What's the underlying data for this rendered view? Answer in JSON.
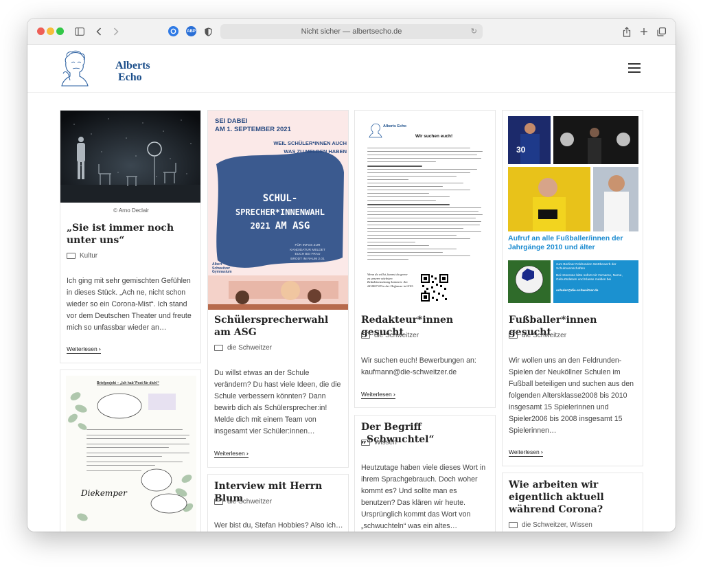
{
  "browser": {
    "address": "Nicht sicher — albertsecho.de",
    "reload_icon": "reload-icon",
    "colors": {
      "close": "#ee5f57",
      "minimize": "#f6bd3b",
      "zoom": "#33c748"
    }
  },
  "site": {
    "logo_line1": "Alberts",
    "logo_line2": "Echo",
    "brand_color": "#1b4e8a"
  },
  "posts": [
    {
      "caption": "© Arno Declair",
      "title": "„Sie ist immer noch unter uns“",
      "category": "Kultur",
      "excerpt": "Ich ging mit sehr gemischten Gefühlen in dieses Stück. „Ach ne, nicht schon wieder so ein Corona-Mist“. Ich stand vor dem Deutschen Theater und freute mich so unfassbar wieder an…",
      "more": "Weiterlesen"
    },
    {
      "image_text": {
        "line1": "SEI DABEI",
        "line2": "AM 1. SEPTEMBER 2021",
        "line3": "WEIL SCHÜLER*INNEN AUCH",
        "line4": "WAS ZU MELDEN HABEN",
        "line5": "SCHUL-",
        "line6": "SPRECHER*INNENWAHL",
        "line7": "2021",
        "line8": "AM ASG",
        "info1": "FÜR INFOS ZUR",
        "info2": "KANDIDATUR MELDET",
        "info3": "EUCH BEI FRAU",
        "info4": "BRODT IM RAUM 2.01",
        "logo1": "Albert",
        "logo2": "Schweitzer",
        "logo3": "Gymnasium"
      },
      "title": "Schülersprecherwahl am ASG",
      "category": "die Schweitzer",
      "excerpt": "Du willst etwas an der Schule verändern? Du hast viele Ideen, die die Schule verbessern könnten? Dann bewirb dich als Schülersprecher:in! Melde dich mit einem Team von insgesamt vier Schüler:innen…",
      "more": "Weiterlesen"
    },
    {
      "image_text": {
        "logo": "Alberts Echo",
        "heading": "Wir suchen euch!",
        "footer1": "Wenn du willst, kannst du gerne",
        "footer2": "zu unserer nächsten",
        "footer3": "Redaktionssitzung kommen: Am",
        "footer4": "24.0867.09 in der Hofpause in 0103."
      },
      "title": "Redakteur*innen gesucht",
      "category": "die Schweitzer",
      "excerpt": "Wir suchen euch! Bewerbungen an: kaufmann@die-schweitzer.de",
      "more": "Weiterlesen"
    },
    {
      "title": "Der Begriff „Schwuchtel“",
      "category": "Wissen",
      "excerpt": "Heutzutage haben viele dieses Wort in ihrem Sprachgebrauch. Doch woher kommt es? Und sollte man es benutzen? Das klären wir heute. Ursprünglich kommt das Wort von „schwuchteln“ was ein altes…"
    },
    {
      "image_text": {
        "headline": "Aufruf an alle Fußballer/innen der Jahrgänge 2010 und älter",
        "box1": "zum Berliner Feldrunden Wettbewerb der Schulmannschaften",
        "box2": "Bei Interesse bitte sofort mit Vorname, Name, Geburtsdatum und Klasse melden bei",
        "email": "schuler@die-schweitzer.de",
        "jersey_number": "30"
      },
      "title": "Fußballer*innen gesucht",
      "category": "die Schweitzer",
      "excerpt": "Wir wollen uns an den Feldrunden-Spielen der Neuköllner Schulen im Fußball beteiligen und suchen aus den folgenden Altersklasse2008 bis 2010 insgesamt 15 Spielerinnen und Spieler2006 bis 2008 insgesamt 15 Spielerinnen…",
      "more": "Weiterlesen"
    },
    {
      "title": "Wie arbeiten wir eigentlich aktuell während Corona?",
      "category": "die Schweitzer, Wissen"
    },
    {
      "image_text": {
        "heading": "Briefprojekt – „Ich hab’ Post für dich!“",
        "signature": "Diekemper"
      }
    },
    {
      "title": "Interview mit Herrn Blum",
      "category": "die Schweitzer",
      "excerpt": "Wer bist du, Stefan Hobbies? Also ich…"
    }
  ]
}
